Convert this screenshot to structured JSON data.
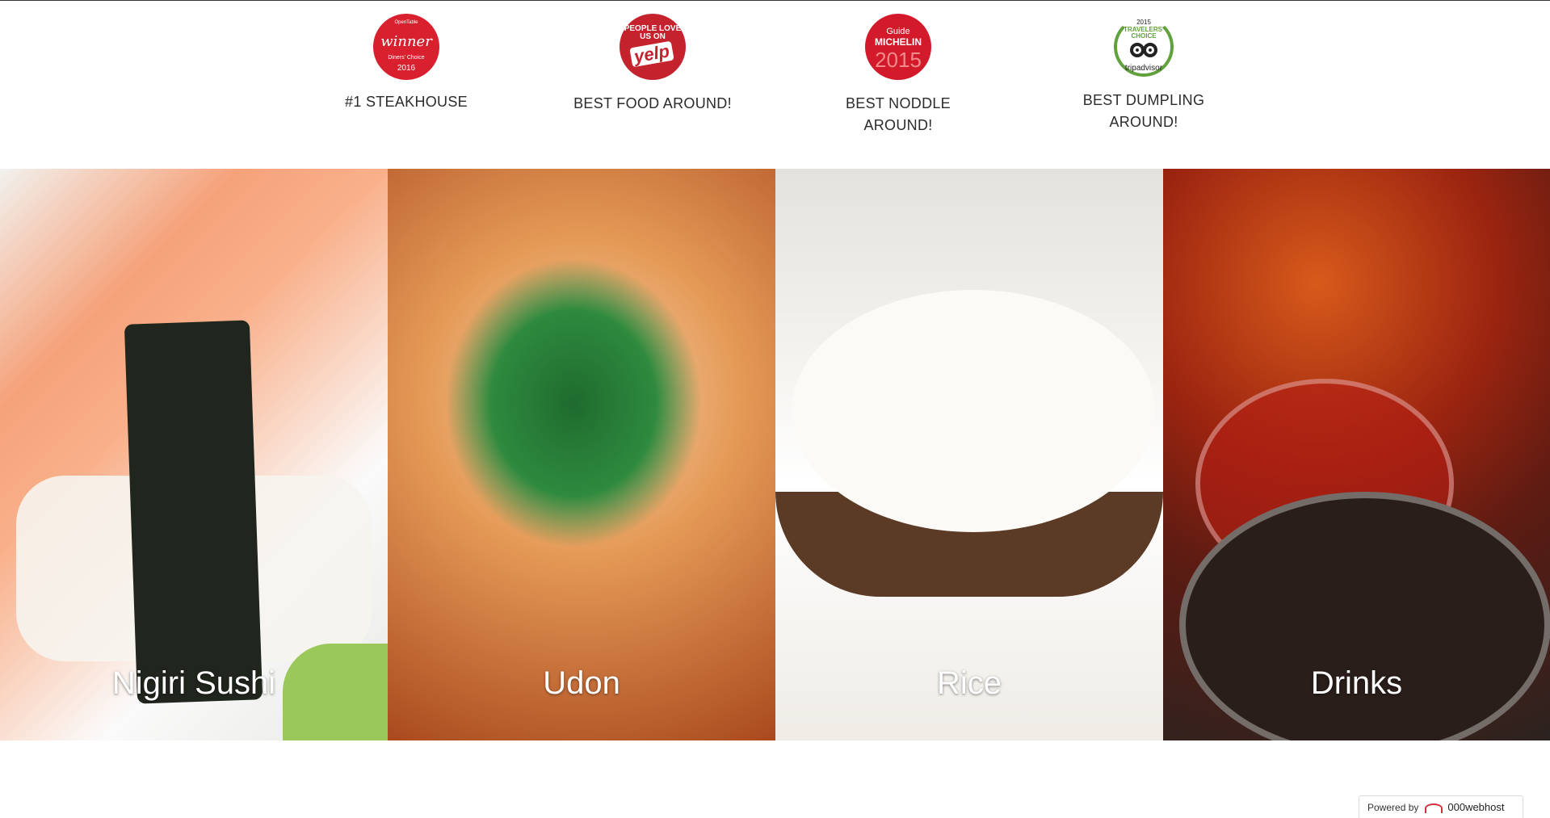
{
  "awards": [
    {
      "badge_name": "opentable-winner-badge",
      "badge_lines": [
        "OpenTable",
        "winner",
        "Diners' Choice",
        "2016"
      ],
      "label": "#1 STEAKHOUSE"
    },
    {
      "badge_name": "yelp-badge",
      "badge_lines": [
        "PEOPLE LOVE US ON",
        "yelp"
      ],
      "label": "BEST FOOD AROUND!"
    },
    {
      "badge_name": "michelin-guide-badge",
      "badge_lines": [
        "Guide",
        "MICHELIN",
        "2015"
      ],
      "label": "BEST NODDLE AROUND!"
    },
    {
      "badge_name": "tripadvisor-badge",
      "badge_lines": [
        "2015",
        "TRAVELERS' CHOICE",
        "tripadvisor"
      ],
      "label": "BEST DUMPLING AROUND!"
    }
  ],
  "gallery": [
    {
      "caption": "Nigiri Sushi"
    },
    {
      "caption": "Udon"
    },
    {
      "caption": "Rice"
    },
    {
      "caption": "Drinks"
    }
  ],
  "footer": {
    "powered_by": "Powered by",
    "brand": "000webhost"
  },
  "colors": {
    "badge_red": "#d8202e",
    "tripadvisor_green": "#5fa13b",
    "caption_text": "#ffffff"
  }
}
